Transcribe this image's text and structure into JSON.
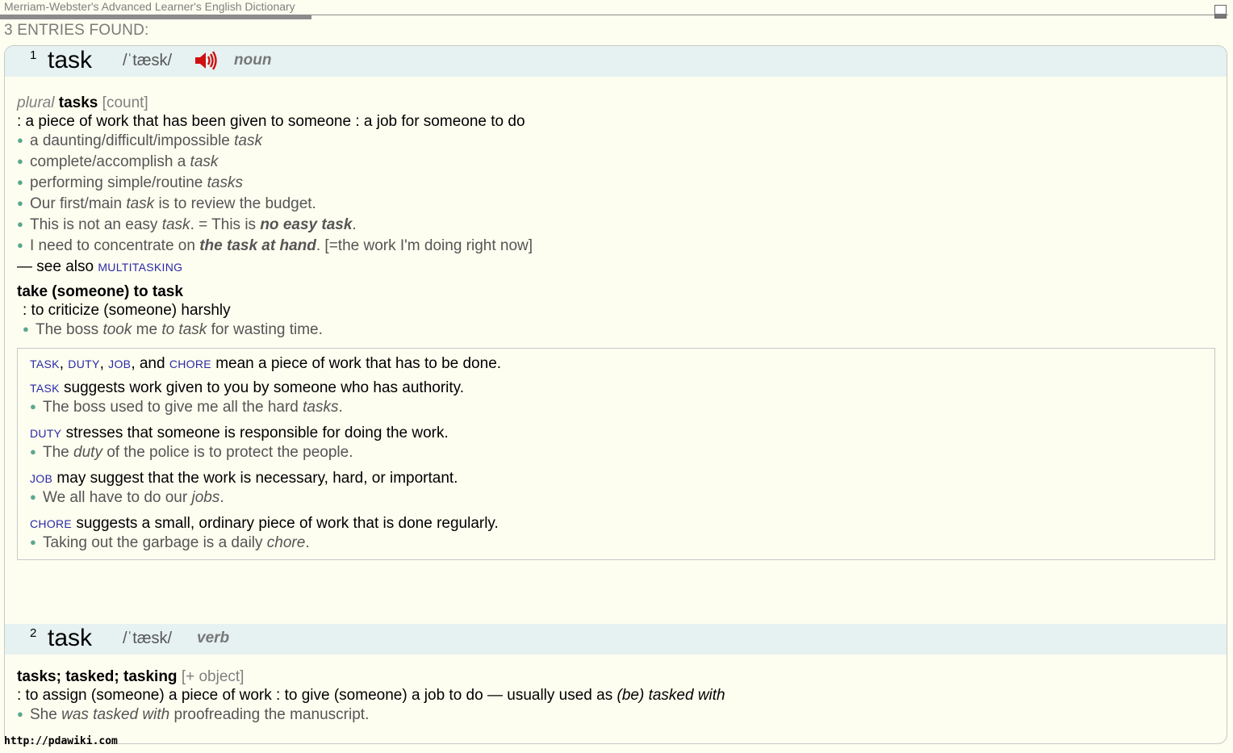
{
  "window": {
    "app_title": "Merriam-Webster's Advanced Learner's English Dictionary"
  },
  "results": {
    "count_label": "3 ENTRIES FOUND:"
  },
  "entry1": {
    "homograph": "1",
    "headword": "task",
    "pronunciation": "/ˈtæsk/",
    "part_of_speech": "noun",
    "inflection_label": "plural",
    "inflection": "tasks",
    "grammar_bracket_open": "[",
    "grammar": "count",
    "grammar_bracket_close": "]",
    "definition": ": a piece of work that has been given to someone : a job for someone to do",
    "examples": [
      {
        "pre": "a daunting/difficult/impossible ",
        "em": "task",
        "post": ""
      },
      {
        "pre": "complete/accomplish a ",
        "em": "task",
        "post": ""
      },
      {
        "pre": "performing simple/routine ",
        "em": "tasks",
        "post": ""
      },
      {
        "pre": "Our first/main ",
        "em": "task",
        "post": " is to review the budget."
      },
      {
        "pre": "This is not an easy ",
        "em": "task",
        "post": ". = This is ",
        "em2": "no easy task",
        "post2": "."
      },
      {
        "pre": "I need to concentrate on ",
        "em": "the task at hand",
        "post": ". [=the work I'm doing right now]"
      }
    ],
    "see_also_label": "— see also",
    "see_also_link": "MULTITASKING",
    "phrase": "take (someone) to task",
    "phrase_definition": ": to criticize (someone) harshly",
    "phrase_example": {
      "pre": "The boss ",
      "em": "took",
      "mid": " me ",
      "em2": "to task",
      "post": " for wasting time."
    },
    "synonyms": {
      "intro_links": [
        "TASK",
        "DUTY",
        "JOB",
        "CHORE"
      ],
      "intro_sep1": ", ",
      "intro_sep2": ", ",
      "intro_sep3": ", and ",
      "intro_text": " mean a piece of work that has to be done.",
      "items": [
        {
          "word": "TASK",
          "text": " suggests work given to you by someone who has authority.",
          "ex_pre": "The boss used to give me all the hard ",
          "ex_em": "tasks",
          "ex_post": "."
        },
        {
          "word": "DUTY",
          "text": " stresses that someone is responsible for doing the work.",
          "ex_pre": "The ",
          "ex_em": "duty",
          "ex_post": " of the police is to protect the people."
        },
        {
          "word": "JOB",
          "text": " may suggest that the work is necessary, hard, or important.",
          "ex_pre": "We all have to do our ",
          "ex_em": "jobs",
          "ex_post": "."
        },
        {
          "word": "CHORE",
          "text": " suggests a small, ordinary piece of work that is done regularly.",
          "ex_pre": "Taking out the garbage is a daily ",
          "ex_em": "chore",
          "ex_post": "."
        }
      ]
    }
  },
  "entry2": {
    "homograph": "2",
    "headword": "task",
    "pronunciation": "/ˈtæsk/",
    "part_of_speech": "verb",
    "inflections": "tasks; tasked; tasking",
    "grammar_bracket_open": "[",
    "grammar": "+ object",
    "grammar_bracket_close": "]",
    "definition": ": to assign (someone) a piece of work : to give (someone) a job to do — usually used as ",
    "definition_em": "(be) tasked with",
    "example": {
      "pre": "She ",
      "em": "was tasked with",
      "post": " proofreading the manuscript."
    }
  },
  "footer": {
    "url": "http://pdawiki.com"
  },
  "icons": {
    "speaker": "speaker-icon",
    "maximize": "maximize-icon"
  },
  "colors": {
    "header_band": "#e6f1f1",
    "background": "#fdfdf0",
    "link": "#2a2aa8",
    "bullet": "#5aa88e",
    "speaker": "#d01010"
  }
}
